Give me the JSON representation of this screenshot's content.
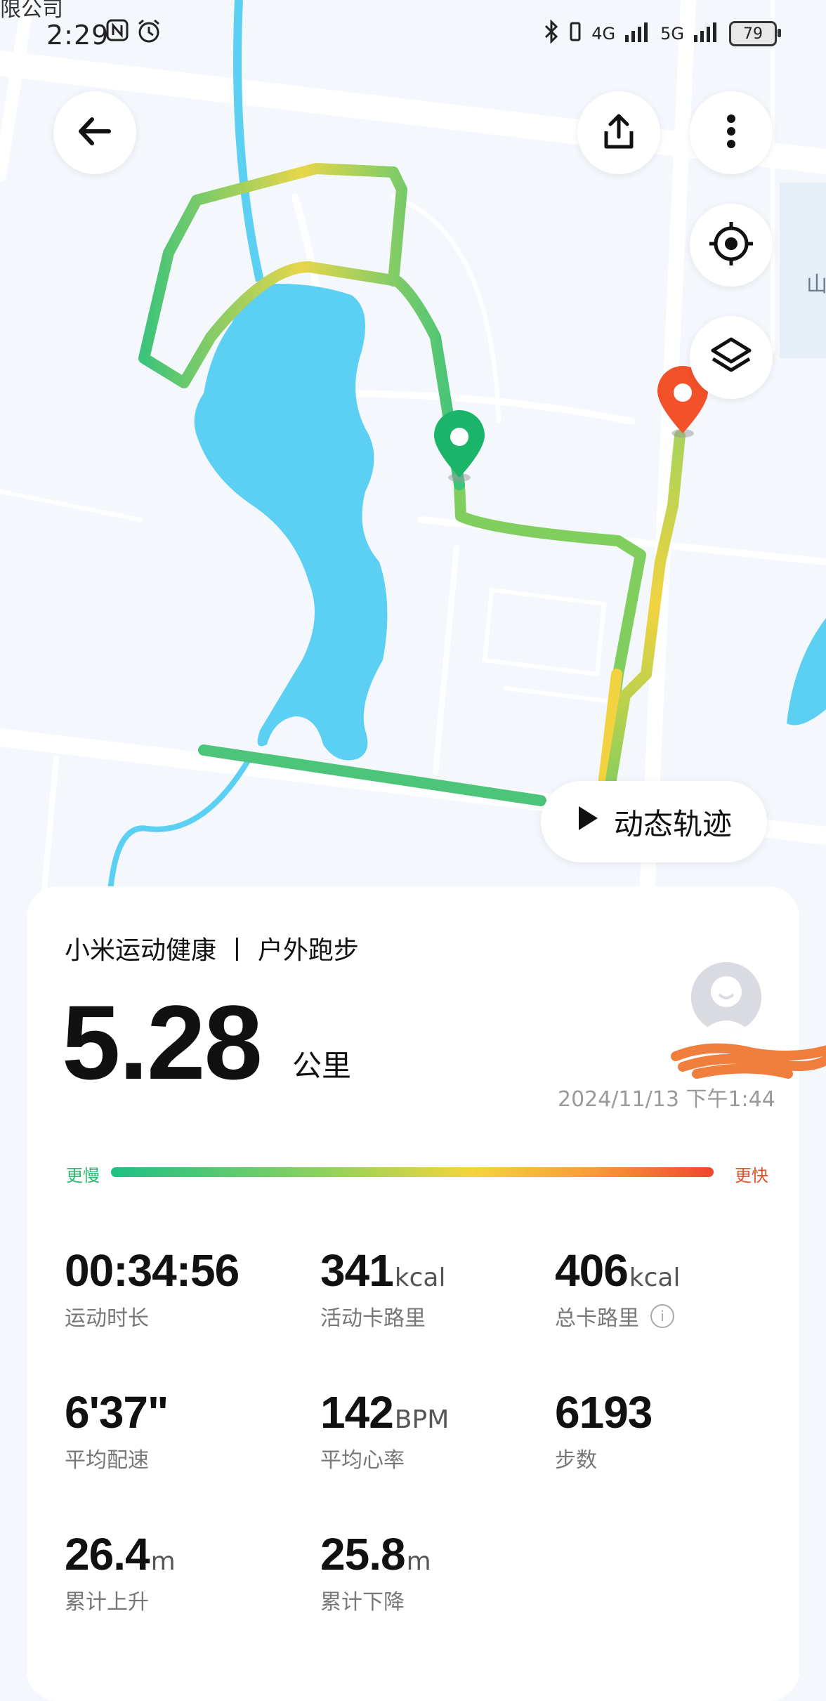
{
  "statusbar": {
    "carrier_text": "限公司",
    "time": "2:29",
    "signal_1": "4G",
    "signal_2": "5G",
    "battery": "79"
  },
  "map": {
    "start_marker_color": "#1bb56a",
    "end_marker_color": "#f2512a",
    "water_color": "#5bd0f3",
    "road_color": "#ffffff",
    "map_bg": "#f4f7fb",
    "label_fragment": "山",
    "dynamic_track_label": "动态轨迹"
  },
  "summary": {
    "sport_title": "小米运动健康 丨 户外跑步",
    "distance": "5.28",
    "distance_unit": "公里",
    "username": "",
    "datetime": "2024/11/13 下午1:44",
    "legend_slow": "更慢",
    "legend_fast": "更快"
  },
  "stats": [
    {
      "value": "00:34:56",
      "unit": "",
      "label": "运动时长"
    },
    {
      "value": "341",
      "unit": "kcal",
      "label": "活动卡路里"
    },
    {
      "value": "406",
      "unit": "kcal",
      "label": "总卡路里"
    },
    {
      "value": "6'37\"",
      "unit": "",
      "label": "平均配速"
    },
    {
      "value": "142",
      "unit": "BPM",
      "label": "平均心率"
    },
    {
      "value": "6193",
      "unit": "",
      "label": "步数"
    },
    {
      "value": "26.4",
      "unit": "m",
      "label": "累计上升"
    },
    {
      "value": "25.8",
      "unit": "m",
      "label": "累计下降"
    }
  ],
  "icons": {
    "back": "back-arrow-icon",
    "share": "share-icon",
    "more": "more-vertical-icon",
    "locate": "locate-icon",
    "layers": "layers-icon",
    "play": "play-icon",
    "info": "info-icon"
  }
}
